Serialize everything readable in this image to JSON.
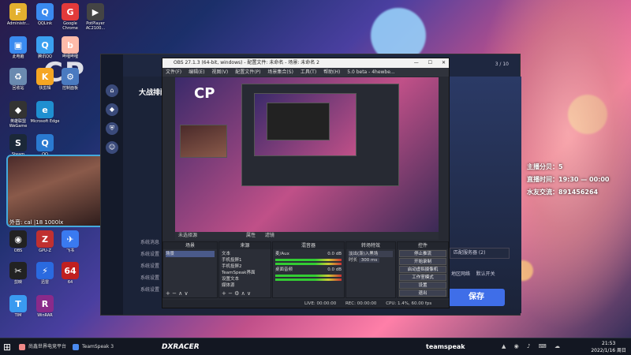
{
  "desktop": {
    "icons": [
      {
        "label": "Administr...",
        "color": "#e3b02f",
        "glyph": "F"
      },
      {
        "label": "QQLink",
        "color": "#3a8af0",
        "glyph": "Q"
      },
      {
        "label": "Google Chrome",
        "color": "#e23a3a",
        "glyph": "G"
      },
      {
        "label": "PotPlayer AC2100...",
        "color": "#444",
        "glyph": "▶"
      },
      {
        "label": "此电脑",
        "color": "#3a8af0",
        "glyph": "▣"
      },
      {
        "label": "腾讯QQ",
        "color": "#3aa0f0",
        "glyph": "Q"
      },
      {
        "label": "哔哩哔哩",
        "color": "#fba",
        "glyph": "b"
      },
      {
        "label": "回收站",
        "color": "#6a8ab0",
        "glyph": "♻"
      },
      {
        "label": "快剪辑",
        "color": "#f5a623",
        "glyph": "K"
      },
      {
        "label": "控制面板",
        "color": "#4a7ac0",
        "glyph": "⚙"
      },
      {
        "label": "英雄联盟WeGame",
        "color": "#333",
        "glyph": "◆"
      },
      {
        "label": "Microsoft Edge",
        "color": "#1f8fd0",
        "glyph": "e"
      },
      {
        "label": "Steam",
        "color": "#1b2838",
        "glyph": "S"
      },
      {
        "label": "QQ",
        "color": "#2a7ad0",
        "glyph": "Q"
      },
      {
        "label": "OBS",
        "color": "#222",
        "glyph": "◉"
      },
      {
        "label": "GPU-Z",
        "color": "#c03030",
        "glyph": "Z"
      },
      {
        "label": "飞书",
        "color": "#3a7af0",
        "glyph": "✈"
      },
      {
        "label": "剪映",
        "color": "#222",
        "glyph": "✂"
      },
      {
        "label": "迅雷",
        "color": "#2a6ae0",
        "glyph": "⚡"
      },
      {
        "label": "64",
        "color": "#c02020",
        "glyph": "64"
      },
      {
        "label": "TIM",
        "color": "#3a9af0",
        "glyph": "T"
      },
      {
        "label": "WinRAR",
        "color": "#8a2a8a",
        "glyph": "R"
      }
    ],
    "logo_text": "CP",
    "cam_label": "外音: cal  |18  1000lx"
  },
  "overlay": {
    "host_label": "主播分贝：",
    "host_value": "5",
    "time_label": "直播时间：",
    "time_value": "19:30 — 00:00",
    "group_label": "水友交流：",
    "group_value": "891456264"
  },
  "back_app": {
    "title": "大战排配",
    "right_value": "3 / 10",
    "list": [
      "系统消息",
      "系统设置",
      "系统设置",
      "系统设置",
      "系统设置"
    ],
    "dropdown": "匹配服务器 (2)",
    "check1": "地区网络",
    "check2": "默认开关",
    "save_label": "保存"
  },
  "obs": {
    "title": "OBS 27.1.3 (64-bit, windows) - 配置文件: 未命名 - 场景: 未命名 2",
    "menu": [
      "文件(F)",
      "编辑(E)",
      "视图(V)",
      "配置文件(P)",
      "场景集合(S)",
      "工具(T)",
      "帮助(H)",
      "5.0 beta - 4hewbe..."
    ],
    "preview_bar": "未选择源",
    "filters_btn": "属性",
    "filters2_btn": "滤镜",
    "docks": {
      "scenes_title": "场景",
      "scenes": [
        "场景"
      ],
      "sources_title": "来源",
      "sources": [
        "文本",
        "手机投屏1",
        "手机投屏2",
        "TeamSpeak界面",
        "设置文本",
        "媒体源"
      ],
      "mixer_title": "混音器",
      "mixer": [
        {
          "name": "麦/Aux",
          "db": "0.0 dB"
        },
        {
          "name": "桌面音频",
          "db": "0.0 dB"
        }
      ],
      "trans_title": "转场特效",
      "trans_type": "淡出(渐)入黑场",
      "trans_dur_label": "时长",
      "trans_dur": "300 ms",
      "controls_title": "控件",
      "controls": [
        "停止推流",
        "开始录制",
        "启动虚拟摄像机",
        "工作室模式",
        "设置",
        "退出"
      ]
    },
    "status": {
      "live": "LIVE: 00:00:00",
      "rec": "REC: 00:00:00",
      "cpu": "CPU: 1.4%, 60.00 fps"
    }
  },
  "taskbar": {
    "items": [
      {
        "label": "尚鑫世界电竞平台",
        "color": "#e88"
      },
      {
        "label": "TeamSpeak 3",
        "color": "#4a8af0"
      }
    ],
    "brand1": "DXRACER",
    "brand2": "teamspeak",
    "clock_time": "21:53",
    "clock_date": "2022/1/16 周日"
  },
  "colors": {
    "accent": "#3f6ee8",
    "overlay_text": "#ffffff"
  }
}
